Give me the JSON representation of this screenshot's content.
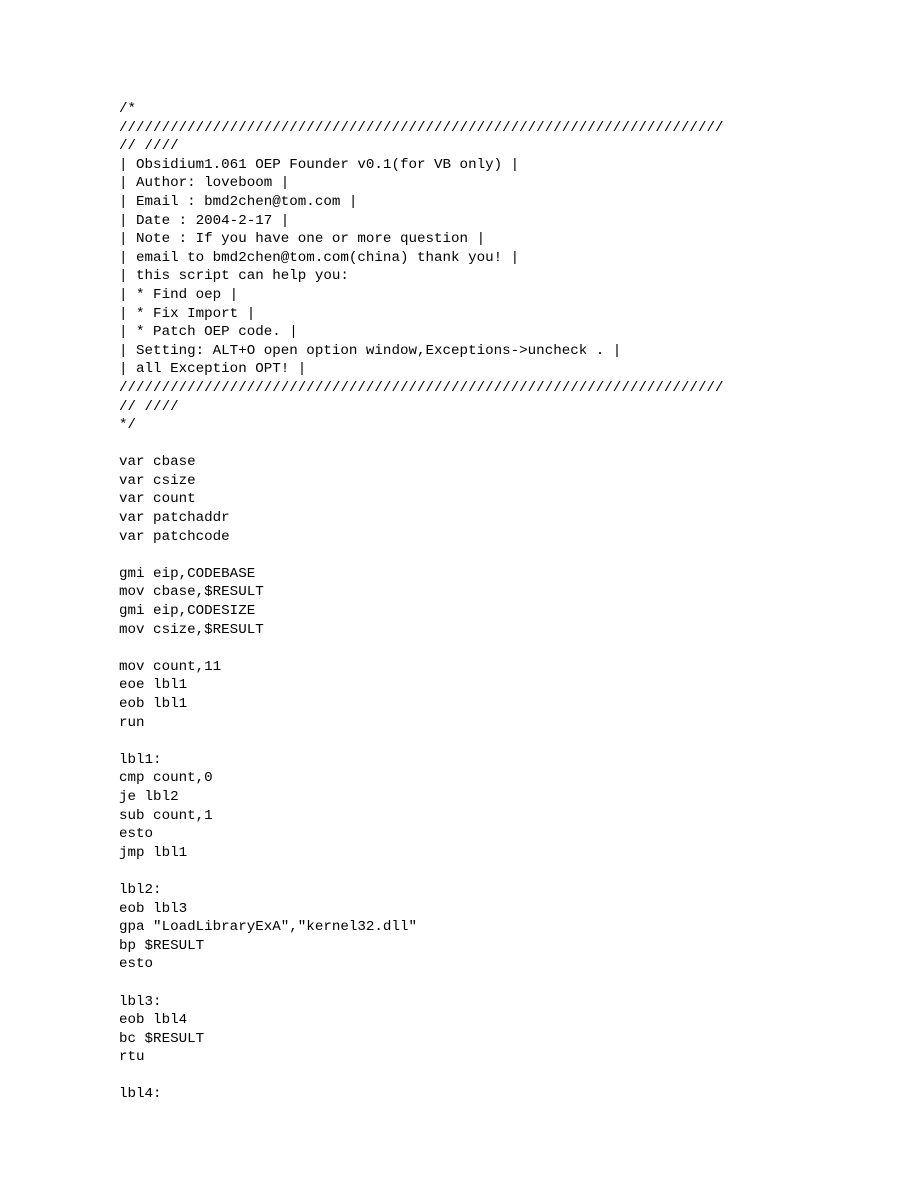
{
  "code_lines": [
    "/*",
    "///////////////////////////////////////////////////////////////////////",
    "// ////",
    "| Obsidium1.061 OEP Founder v0.1(for VB only) |",
    "| Author: loveboom |",
    "| Email : bmd2chen@tom.com |",
    "| Date : 2004-2-17 |",
    "| Note : If you have one or more question |",
    "| email to bmd2chen@tom.com(china) thank you! |",
    "| this script can help you:",
    "| * Find oep |",
    "| * Fix Import |",
    "| * Patch OEP code. |",
    "| Setting: ALT+O open option window,Exceptions->uncheck . |",
    "| all Exception OPT! |",
    "///////////////////////////////////////////////////////////////////////",
    "// ////",
    "*/",
    "",
    "var cbase",
    "var csize",
    "var count",
    "var patchaddr",
    "var patchcode",
    "",
    "gmi eip,CODEBASE",
    "mov cbase,$RESULT",
    "gmi eip,CODESIZE",
    "mov csize,$RESULT",
    "",
    "mov count,11",
    "eoe lbl1",
    "eob lbl1",
    "run",
    "",
    "lbl1:",
    "cmp count,0",
    "je lbl2",
    "sub count,1",
    "esto",
    "jmp lbl1",
    "",
    "lbl2:",
    "eob lbl3",
    "gpa \"LoadLibraryExA\",\"kernel32.dll\"",
    "bp $RESULT",
    "esto",
    "",
    "lbl3:",
    "eob lbl4",
    "bc $RESULT",
    "rtu",
    "",
    "lbl4:"
  ]
}
